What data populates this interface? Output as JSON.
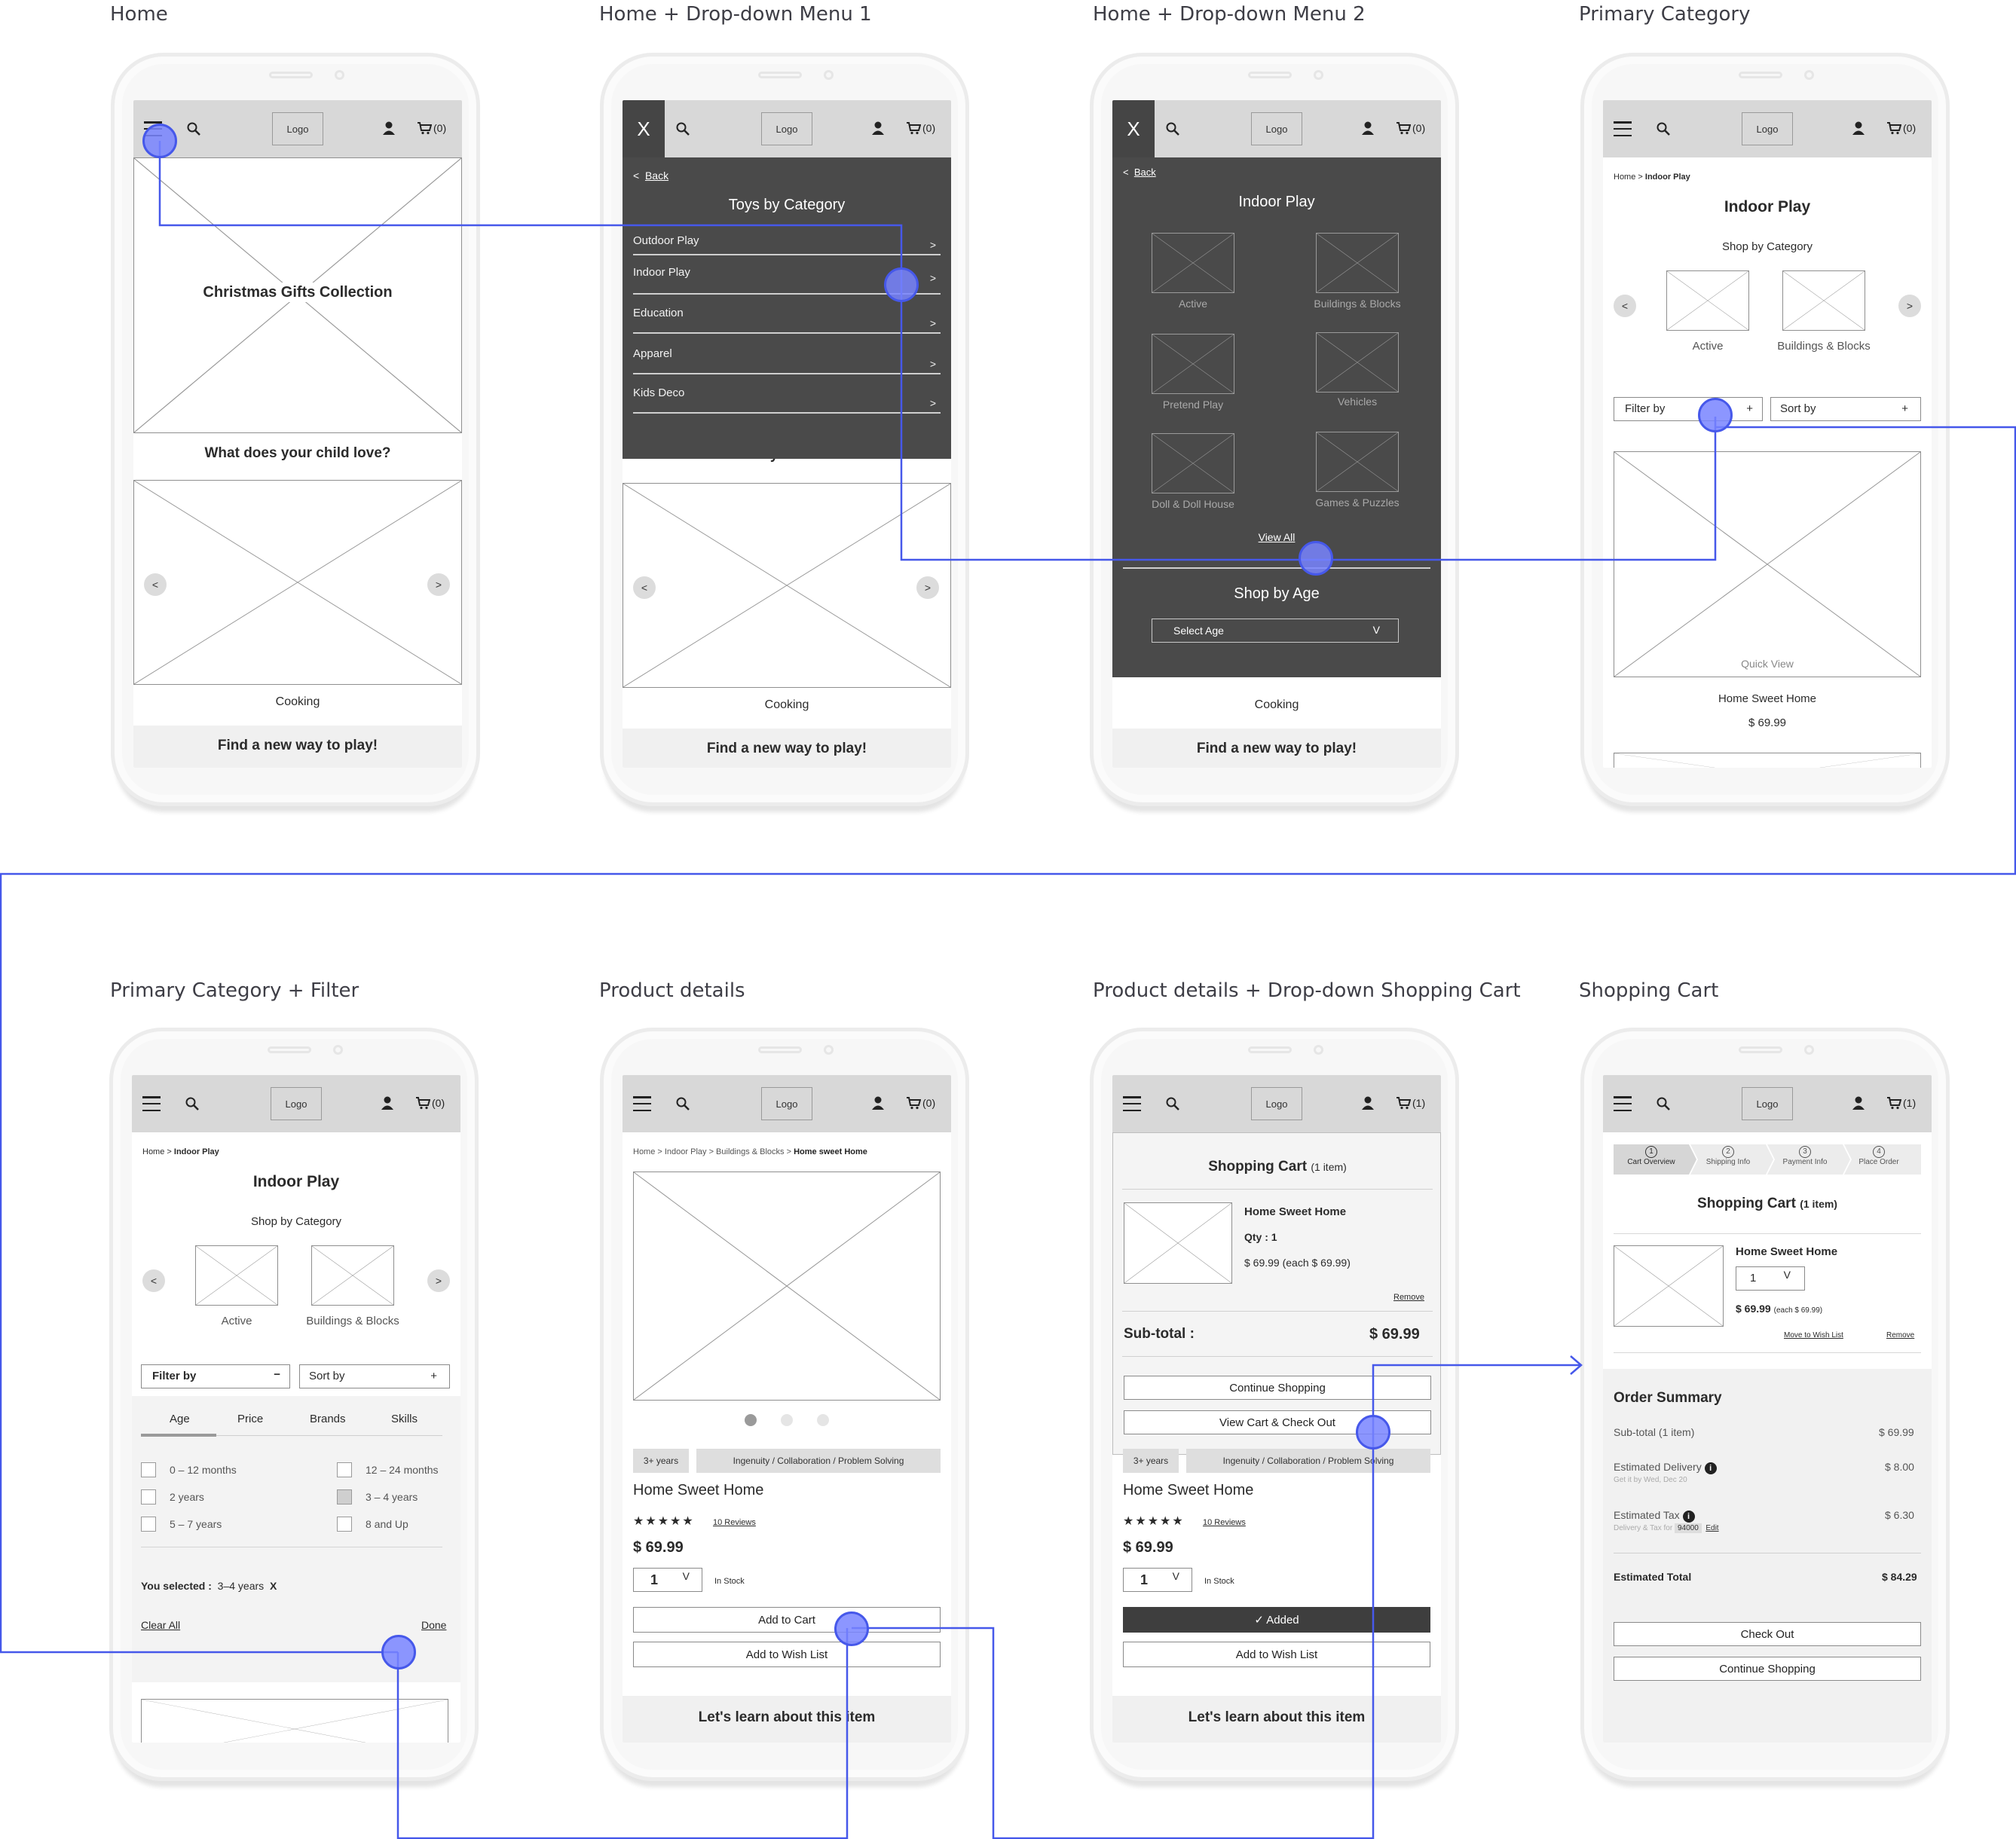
{
  "screens": [
    {
      "title": "Home"
    },
    {
      "title": "Home + Drop-down Menu 1"
    },
    {
      "title": "Home + Drop-down Menu 2"
    },
    {
      "title": "Primary Category"
    },
    {
      "title": "Primary Category + Filter"
    },
    {
      "title": "Product details"
    },
    {
      "title": "Product details + Drop-down Shopping Cart"
    },
    {
      "title": "Shopping Cart"
    }
  ],
  "header": {
    "logo": "Logo",
    "cart_empty": "(0)",
    "cart_one": "(1)",
    "close": "X"
  },
  "home": {
    "hero": "Christmas Gifts Collection",
    "question": "What does your child love?",
    "carousel_prev": "<",
    "carousel_next": ">",
    "carousel_label": "Cooking",
    "footer": "Find a new way to play!"
  },
  "menu1": {
    "back": "Back",
    "back_arrow": "<",
    "heading": "Toys by Category",
    "items": [
      {
        "label": "Outdoor Play",
        "arrow": ">"
      },
      {
        "label": "Indoor Play",
        "arrow": ">"
      },
      {
        "label": "Education",
        "arrow": ">"
      },
      {
        "label": "Apparel",
        "arrow": ">"
      },
      {
        "label": "Kids Deco",
        "arrow": ">"
      }
    ],
    "peek": "What does your child love?"
  },
  "menu2": {
    "back": "Back",
    "back_arrow": "<",
    "heading": "Indoor Play",
    "tiles": [
      "Active",
      "Buildings & Blocks",
      "Pretend Play",
      "Vehicles",
      "Doll & Doll House",
      "Games & Puzzles"
    ],
    "view_all": "View All",
    "age_heading": "Shop by Age",
    "age_select": "Select Age",
    "age_caret": "V"
  },
  "category": {
    "crumb_home": "Home",
    "crumb_sep": " > ",
    "crumb_current": "Indoor Play",
    "title": "Indoor Play",
    "shop_by": "Shop by Category",
    "tiles": [
      "Active",
      "Buildings & Blocks"
    ],
    "filter": "Filter by",
    "filter_plus": "+",
    "filter_minus": "−",
    "sort": "Sort by",
    "sort_plus": "+",
    "quick_view": "Quick View",
    "product": "Home Sweet Home",
    "price": "$ 69.99"
  },
  "filter": {
    "tabs": [
      "Age",
      "Price",
      "Brands",
      "Skills"
    ],
    "options": [
      {
        "label": "0 – 12 months",
        "checked": false
      },
      {
        "label": "12 – 24 months",
        "checked": false
      },
      {
        "label": "2 years",
        "checked": false
      },
      {
        "label": "3 – 4 years",
        "checked": true
      },
      {
        "label": "5 – 7 years",
        "checked": false
      },
      {
        "label": "8 and Up",
        "checked": false
      }
    ],
    "you_selected": "You selected :",
    "selection": "3–4 years",
    "remove": "X",
    "clear": "Clear All",
    "done": "Done"
  },
  "product": {
    "crumb": "Home > Indoor Play > Buildings & Blocks > ",
    "crumb_current": "Home sweet Home",
    "age_tag": "3+ years",
    "skills_tag": "Ingenuity / Collaboration / Problem Solving",
    "name": "Home Sweet Home",
    "stars": "★★★★★",
    "reviews": "10 Reviews",
    "price": "$ 69.99",
    "qty": "1",
    "qty_caret": "V",
    "stock": "In Stock",
    "add_to_cart": "Add to Cart",
    "added": "✓  Added",
    "wishlist": "Add to Wish List",
    "learn": "Let's learn about this item"
  },
  "minicart": {
    "title": "Shopping Cart",
    "count": "(1 item)",
    "name": "Home Sweet Home",
    "qty": "Qty : 1",
    "price_line": "$ 69.99 (each $ 69.99)",
    "remove": "Remove",
    "subtotal_label": "Sub-total :",
    "subtotal": "$ 69.99",
    "continue": "Continue Shopping",
    "checkout": "View Cart & Check Out"
  },
  "cart": {
    "steps": [
      {
        "n": "1",
        "label": "Cart Overview"
      },
      {
        "n": "2",
        "label": "Shipping Info"
      },
      {
        "n": "3",
        "label": "Payment Info"
      },
      {
        "n": "4",
        "label": "Place Order"
      }
    ],
    "title": "Shopping Cart",
    "count": "(1 item)",
    "name": "Home Sweet Home",
    "qty": "1",
    "qty_caret": "V",
    "price": "$ 69.99",
    "each": "(each $ 69.99)",
    "move_wish": "Move to Wish List",
    "remove": "Remove",
    "summary_title": "Order Summary",
    "subtotal_label": "Sub-total (1 item)",
    "subtotal": "$ 69.99",
    "delivery_label": "Estimated Delivery",
    "delivery_note": "Get it by Wed, Dec 20",
    "delivery": "$ 8.00",
    "tax_label": "Estimated Tax",
    "tax_note": "Delivery & Tax for",
    "zip": "94000",
    "edit": "Edit",
    "tax": "$ 6.30",
    "total_label": "Estimated Total",
    "total": "$ 84.29",
    "checkout": "Check Out",
    "continue": "Continue Shopping"
  },
  "colors": {
    "flow_line": "#4658ea",
    "hotspot": "#7884ff",
    "dark_panel": "#4a4a4a",
    "header": "#d8d8d8"
  },
  "icons": [
    "hamburger-icon",
    "search-icon",
    "user-icon",
    "cart-icon",
    "close-icon",
    "info-icon"
  ]
}
